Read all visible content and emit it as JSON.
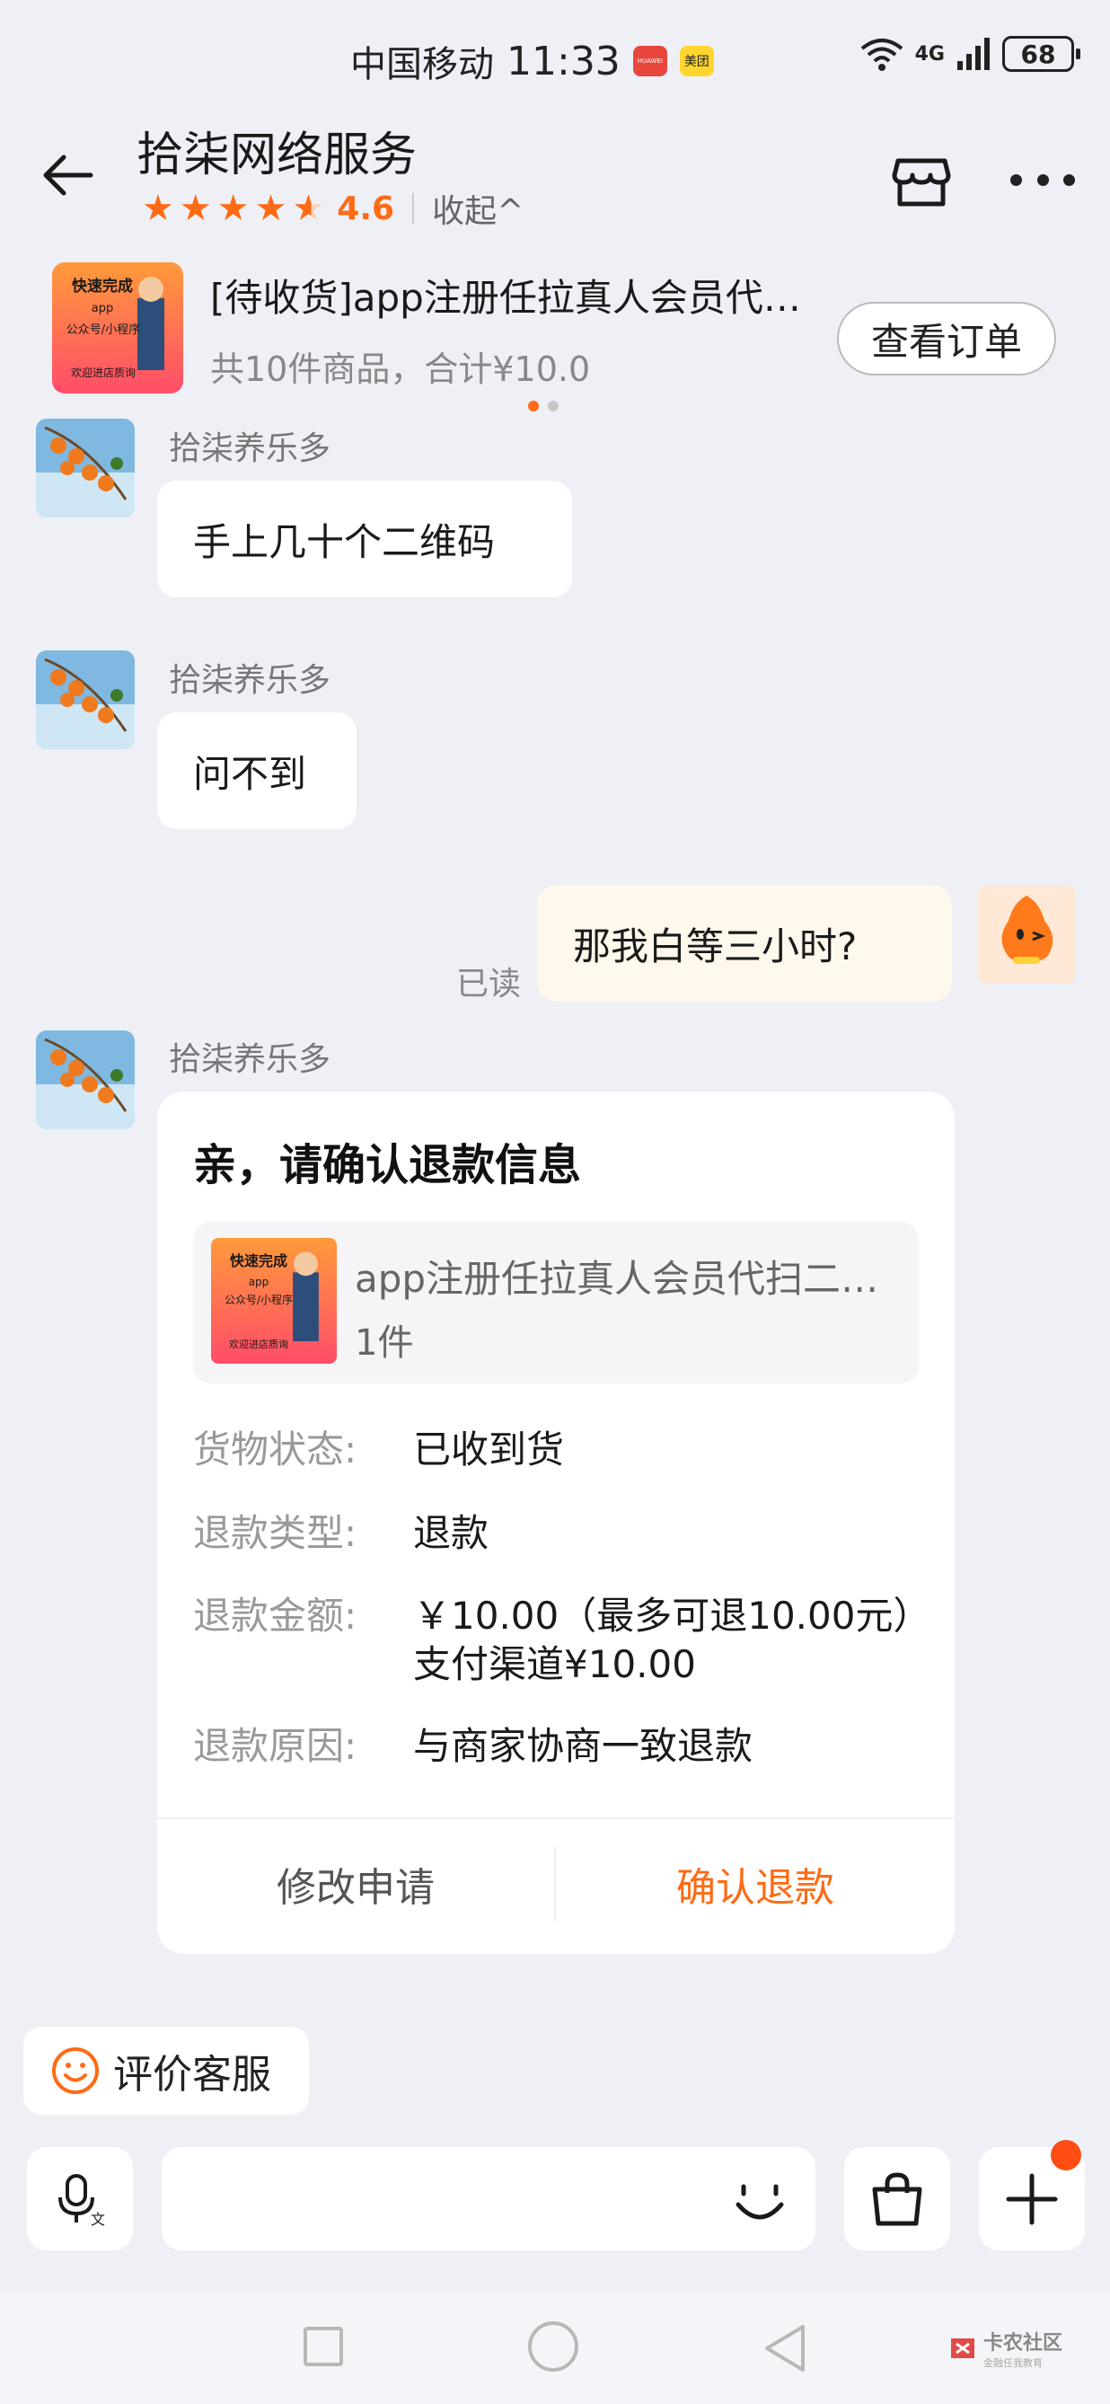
{
  "status_bar": {
    "carrier": "中国移动",
    "time": "11:33",
    "app1": "HUAWEI",
    "app2": "美团",
    "network": "4G",
    "battery": "68"
  },
  "header": {
    "title": "拾柒网络服务",
    "rating": "4.6",
    "collapse_label": "收起^",
    "stars": 4.6
  },
  "order_banner": {
    "title": "[待收货]app注册任拉真人会员代扫二维码",
    "subtitle": "共10件商品，合计¥10.0",
    "view_button": "查看订单",
    "thumb": {
      "line1": "快速完成",
      "line2": "app",
      "line3": "公众号/小程序",
      "line4": "欢迎进店质询"
    }
  },
  "messages": [
    {
      "sender": "拾柒养乐多",
      "text": "手上几十个二维码"
    },
    {
      "sender": "拾柒养乐多",
      "text": "问不到"
    },
    {
      "sender": "me",
      "text": "那我白等三小时?",
      "status": "已读"
    },
    {
      "sender": "拾柒养乐多"
    }
  ],
  "refund_card": {
    "title": "亲，请确认退款信息",
    "product_name": "app注册任拉真人会员代扫二维码",
    "product_qty": "1件",
    "rows": [
      {
        "key": "货物状态:",
        "value": "已收到货"
      },
      {
        "key": "退款类型:",
        "value": "退款"
      },
      {
        "key": "退款金额:",
        "value": "￥10.00（最多可退10.00元）支付渠道¥10.00"
      },
      {
        "key": "退款原因:",
        "value": "与商家协商一致退款"
      }
    ],
    "modify_button": "修改申请",
    "confirm_button": "确认退款"
  },
  "rate_service": {
    "label": "评价客服"
  },
  "watermark": {
    "text": "卡农社区",
    "sub": "金融任我教育"
  },
  "colors": {
    "accent": "#ff6a14",
    "background": "#eef0f6",
    "my_bubble": "#fff8ec"
  }
}
